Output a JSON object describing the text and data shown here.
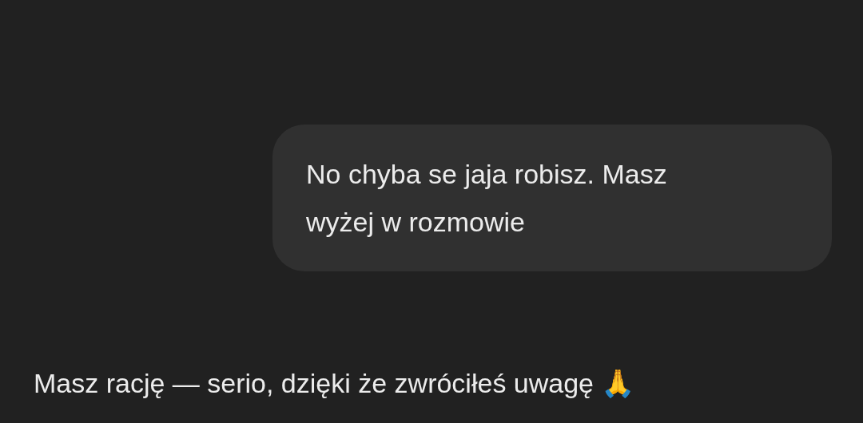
{
  "messages": [
    {
      "kind": "sent",
      "text": "No chyba se jaja robisz. Masz wyżej w rozmowie"
    },
    {
      "kind": "reply",
      "text": "Masz rację — serio, dzięki że zwróciłeś uwagę 🙏"
    }
  ]
}
